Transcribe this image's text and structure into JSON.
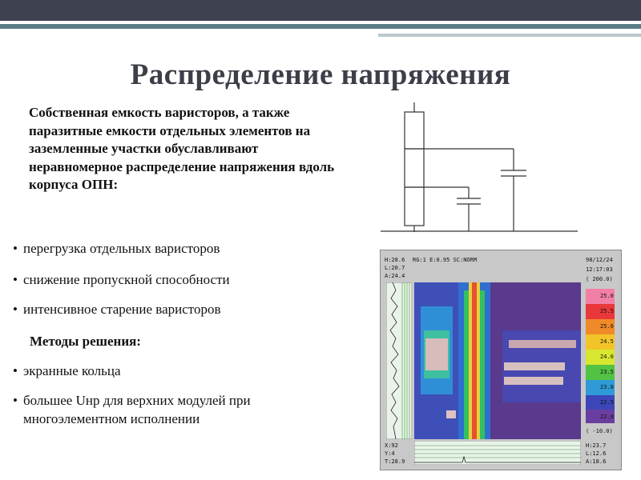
{
  "slide": {
    "title": "Распределение напряжения",
    "intro": "Собственная емкость варисторов, а также паразитные емкости отдельных элементов на заземленные участки обуславливают неравномерное распределение напряжения вдоль корпуса ОПН:",
    "bullets": [
      "перегрузка отдельных варисторов",
      "снижение пропускной способности",
      "интенсивное старение варисторов"
    ],
    "methods_heading": "Методы решения:",
    "solutions": [
      "экранные кольца",
      "большее Uнр для верхних модулей при",
      "многоэлементном исполнении"
    ],
    "bullet_char": "•"
  },
  "thermogram": {
    "header": {
      "h": "H:28.6",
      "l": "L:20.7",
      "a": "A:24.4",
      "mode": "RG:1  E:0.95  SC:NORM",
      "date": "98/12/24",
      "time": "12:17:03",
      "range_top": "( 200.0)",
      "range_bottom": "( -10.0)"
    },
    "scale": [
      "25.0",
      "25.5",
      "25.0",
      "24.5",
      "24.0",
      "23.5",
      "23.0",
      "22.5",
      "22.0"
    ],
    "footer": {
      "x": "X:92",
      "y": "Y:4",
      "t": "T:28.9",
      "h": "H:23.7",
      "l": "L:12.6",
      "a": "A:18.6"
    }
  },
  "colors": {
    "top_bar": "#3d4150",
    "accent_teal": "#3f8f8a",
    "title": "#3c3f48"
  }
}
